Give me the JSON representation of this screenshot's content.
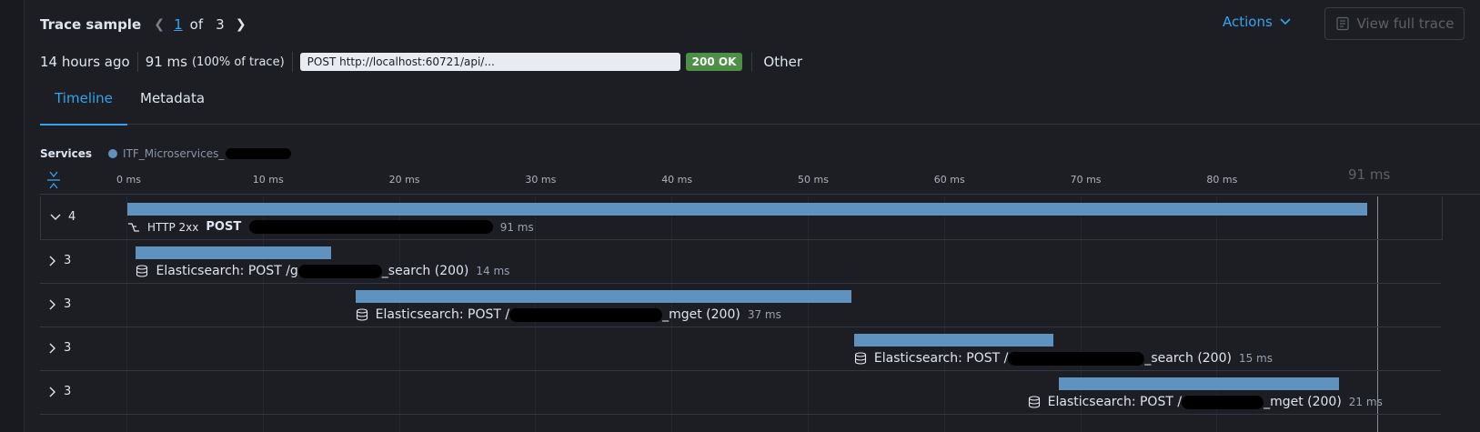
{
  "header": {
    "title": "Trace sample",
    "pager": {
      "current": "1",
      "of_label": "of",
      "total": "3"
    },
    "actions_label": "Actions",
    "view_full_trace_label": "View full trace"
  },
  "summary": {
    "time_ago": "14 hours ago",
    "duration": "91 ms",
    "duration_detail": "(100% of trace)",
    "url": "POST http://localhost:60721/api/...",
    "status": "200 OK",
    "outcome": "Other"
  },
  "tabs": [
    {
      "label": "Timeline",
      "active": true
    },
    {
      "label": "Metadata",
      "active": false
    }
  ],
  "services": {
    "label": "Services",
    "items": [
      {
        "name": "ITF_Microservices_",
        "color": "#6092c0"
      }
    ]
  },
  "timeline": {
    "ticks": [
      "0 ms",
      "10 ms",
      "20 ms",
      "30 ms",
      "40 ms",
      "50 ms",
      "60 ms",
      "70 ms",
      "80 ms"
    ],
    "end_label": "91 ms",
    "total_ms": 91,
    "rows": [
      {
        "count": "4",
        "expanded": true,
        "http_tag": "HTTP 2xx",
        "name": "POST ",
        "duration": "91 ms",
        "start_ms": 0,
        "duration_ms": 91,
        "icon": "transaction-icon"
      },
      {
        "count": "3",
        "expanded": false,
        "name_prefix": "Elasticsearch: POST /g",
        "name_suffix": "_search (200)",
        "duration": "14 ms",
        "start_ms": 0.7,
        "duration_ms": 14.3,
        "icon": "database-icon"
      },
      {
        "count": "3",
        "expanded": false,
        "name_prefix": "Elasticsearch: POST /",
        "name_suffix": "_mget (200)",
        "duration": "37 ms",
        "start_ms": 16.8,
        "duration_ms": 36.4,
        "icon": "database-icon"
      },
      {
        "count": "3",
        "expanded": false,
        "name_prefix": "Elasticsearch: POST /",
        "name_suffix": "_search (200)",
        "duration": "15 ms",
        "start_ms": 53.4,
        "duration_ms": 14.6,
        "icon": "database-icon"
      },
      {
        "count": "3",
        "expanded": false,
        "name_prefix": "Elasticsearch: POST /",
        "name_suffix": "_mget (200)",
        "duration": "21 ms",
        "start_ms": 68.4,
        "duration_ms": 20.6,
        "icon": "database-icon"
      }
    ]
  },
  "colors": {
    "accent": "#36a2ef",
    "bar": "#6092c0",
    "success": "#4d8f45"
  }
}
